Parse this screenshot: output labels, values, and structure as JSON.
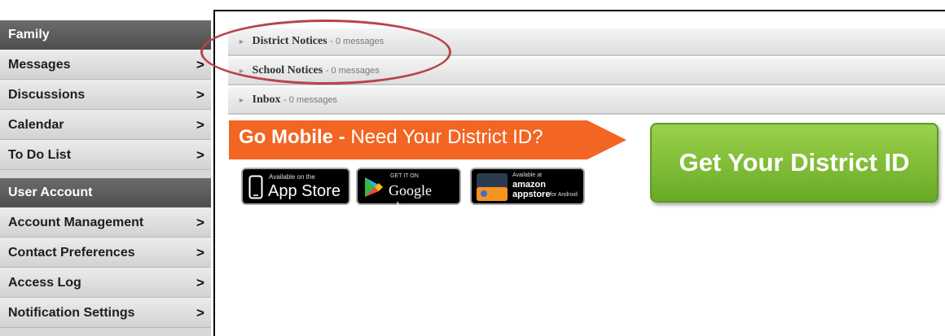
{
  "sidebar": {
    "sections": [
      {
        "header": "Family",
        "items": [
          {
            "label": "Messages"
          },
          {
            "label": "Discussions"
          },
          {
            "label": "Calendar"
          },
          {
            "label": "To Do List"
          }
        ]
      },
      {
        "header": "User Account",
        "items": [
          {
            "label": "Account Management"
          },
          {
            "label": "Contact Preferences"
          },
          {
            "label": "Access Log"
          },
          {
            "label": "Notification Settings"
          }
        ]
      }
    ],
    "chevron": ">"
  },
  "notices": [
    {
      "title": "District Notices",
      "count": "- 0 messages"
    },
    {
      "title": "School Notices",
      "count": "- 0 messages"
    },
    {
      "title": "Inbox",
      "count": "- 0 messages"
    }
  ],
  "mobile": {
    "banner_bold": "Go Mobile -",
    "banner_text": " Need Your District ID?",
    "banner_color": "#f26522",
    "get_id_label": "Get Your District ID",
    "get_id_color": "#7cbd34"
  },
  "badges": {
    "app_store": {
      "small": "Available on the",
      "big": "App Store"
    },
    "google_play": {
      "small": "GET IT ON",
      "big": "Google play"
    },
    "amazon": {
      "small": "Available at",
      "brand": "amazon appstore",
      "sub": "for Android"
    }
  },
  "highlight_color": "#b5454a"
}
